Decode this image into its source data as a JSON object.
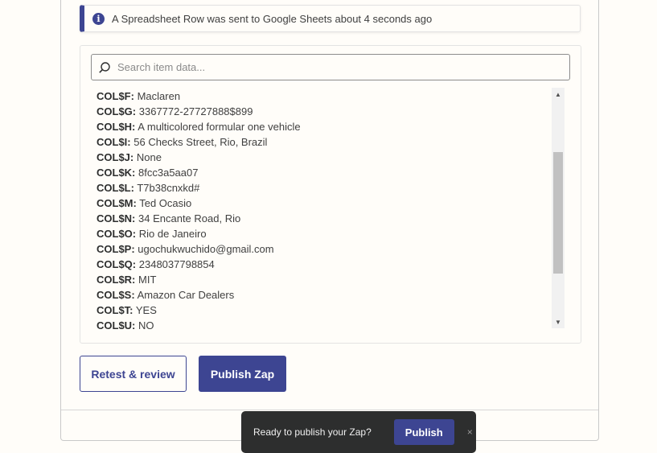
{
  "alert": {
    "icon": "info-icon",
    "message": "A Spreadsheet Row was sent to Google Sheets about 4 seconds ago"
  },
  "search": {
    "placeholder": "Search item data..."
  },
  "items": [
    {
      "key": "COL$F:",
      "value": "Maclaren"
    },
    {
      "key": "COL$G:",
      "value": "3367772-27727888$899"
    },
    {
      "key": "COL$H:",
      "value": "A multicolored formular one vehicle"
    },
    {
      "key": "COL$I:",
      "value": "56 Checks Street, Rio, Brazil"
    },
    {
      "key": "COL$J:",
      "value": "None"
    },
    {
      "key": "COL$K:",
      "value": "8fcc3a5aa07"
    },
    {
      "key": "COL$L:",
      "value": "T7b38cnxkd#"
    },
    {
      "key": "COL$M:",
      "value": "Ted Ocasio"
    },
    {
      "key": "COL$N:",
      "value": "34 Encante Road, Rio"
    },
    {
      "key": "COL$O:",
      "value": "Rio de Janeiro"
    },
    {
      "key": "COL$P:",
      "value": "ugochukwuchido@gmail.com"
    },
    {
      "key": "COL$Q:",
      "value": "2348037798854"
    },
    {
      "key": "COL$R:",
      "value": "MIT"
    },
    {
      "key": "COL$S:",
      "value": "Amazon Car Dealers"
    },
    {
      "key": "COL$T:",
      "value": "YES"
    },
    {
      "key": "COL$U:",
      "value": "NO"
    }
  ],
  "actions": {
    "retest_label": "Retest & review",
    "publish_label": "Publish Zap"
  },
  "toast": {
    "message": "Ready to publish your Zap?",
    "publish_label": "Publish",
    "close_glyph": "×"
  },
  "colors": {
    "accent": "#3d4592",
    "toast_bg": "#2d2e2e",
    "background": "#fffdf9"
  }
}
